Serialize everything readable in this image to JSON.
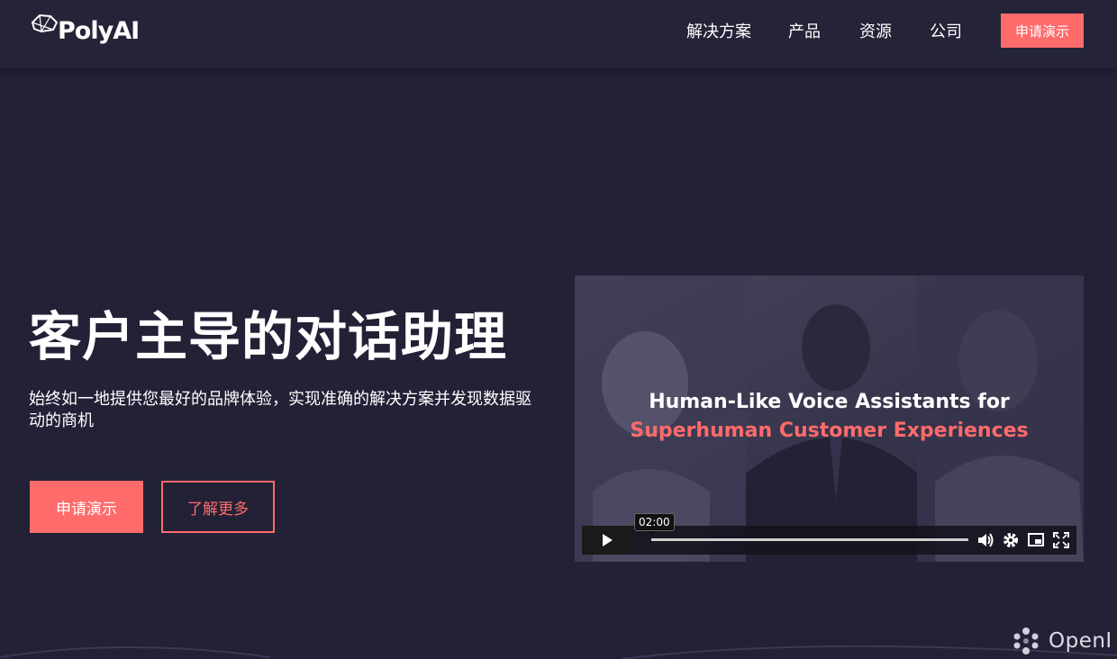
{
  "brand": {
    "name": "PolyAI",
    "logo_icon": "polyai-logo-icon"
  },
  "nav": {
    "items": [
      {
        "label": "解决方案"
      },
      {
        "label": "产品"
      },
      {
        "label": "资源"
      },
      {
        "label": "公司"
      }
    ],
    "cta_label": "申请演示"
  },
  "hero": {
    "title": "客户主导的对话助理",
    "subtitle": "始终如一地提供您最好的品牌体验，实现准确的解决方案并发现数据驱动的商机",
    "primary_button": "申请演示",
    "secondary_button": "了解更多"
  },
  "video": {
    "title_line1": "Human-Like Voice Assistants for",
    "title_line2": "Superhuman Customer Experiences",
    "duration": "02:00",
    "progress": 0,
    "icons": [
      "play-icon",
      "volume-icon",
      "settings-icon",
      "pip-icon",
      "fullscreen-icon"
    ]
  },
  "watermark": {
    "text": "OpenI"
  },
  "colors": {
    "background": "#232136",
    "accent": "#ff6b6b",
    "text": "#ffffff"
  }
}
